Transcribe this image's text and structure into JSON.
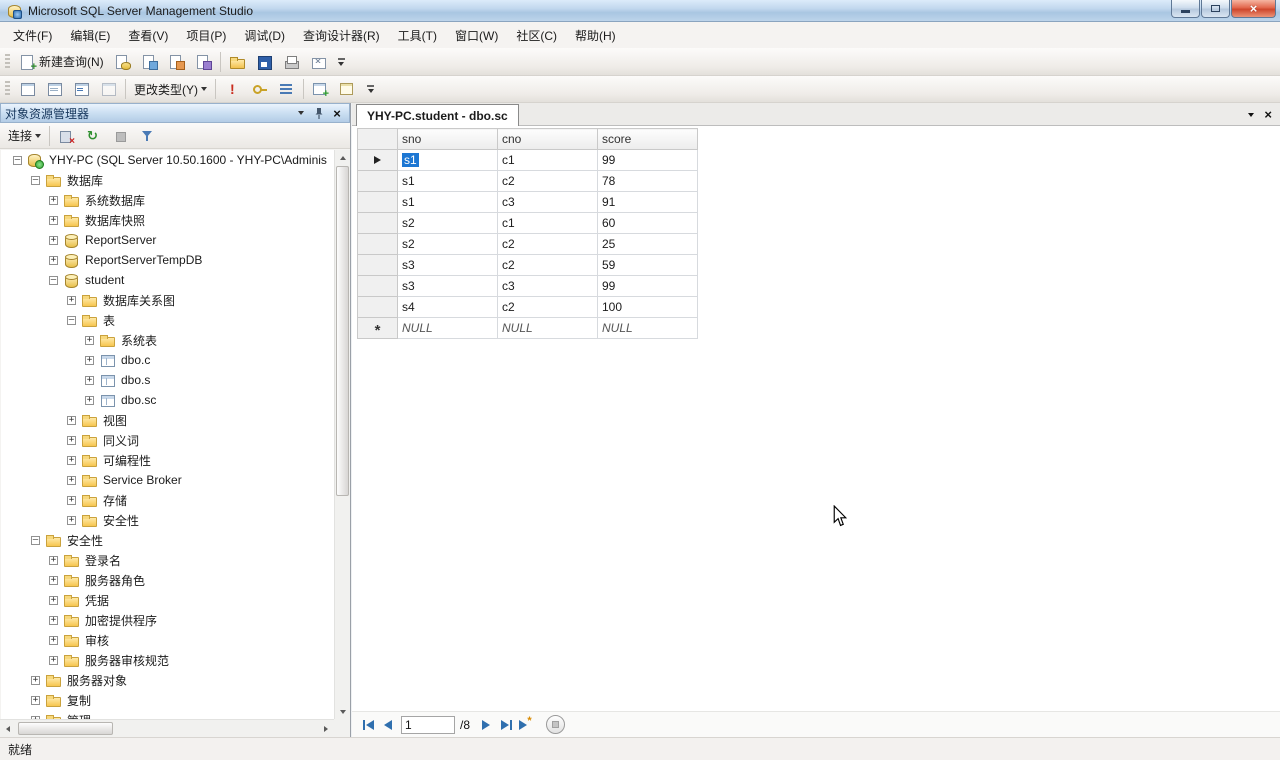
{
  "colors": {
    "titlebar_blue": "#b9d1e9",
    "close_red": "#ce462c",
    "selection_blue": "#1d77d3",
    "panel_header_blue": "#b3cce6",
    "nav_arrow_blue": "#2f6fae"
  },
  "window": {
    "title": "Microsoft SQL Server Management Studio"
  },
  "menu": {
    "items": [
      "文件(F)",
      "编辑(E)",
      "查看(V)",
      "项目(P)",
      "调试(D)",
      "查询设计器(R)",
      "工具(T)",
      "窗口(W)",
      "社区(C)",
      "帮助(H)"
    ]
  },
  "toolbar_standard": {
    "new_query_label": "新建查询(N)",
    "icons": [
      "database-engine-query-icon",
      "mdx-query-icon",
      "dmx-query-icon",
      "xmla-query-icon"
    ],
    "file_icons": [
      "open-file-icon",
      "save-icon",
      "print-icon",
      "mail-icon"
    ]
  },
  "toolbar_query": {
    "pane_icons": [
      "show-diagram-pane-icon",
      "show-grid-pane-icon",
      "show-sql-pane-icon",
      "show-results-pane-icon"
    ],
    "change_type_label": "更改类型(Y)",
    "exec_icons": [
      "execute-sql-icon",
      "verify-sql-icon",
      "add-group-by-icon"
    ],
    "table_icons": [
      "add-table-icon",
      "add-derived-table-icon"
    ]
  },
  "object_explorer": {
    "title": "对象资源管理器",
    "connect_label": "连接",
    "toolbar_icons": [
      "disconnect-icon",
      "refresh-icon",
      "stop-icon",
      "filter-icon"
    ],
    "tree": [
      {
        "label": "YHY-PC (SQL Server 10.50.1600 - YHY-PC\\Adminis",
        "level": 0,
        "expand": "-",
        "icon": "server"
      },
      {
        "label": "数据库",
        "level": 1,
        "expand": "-",
        "icon": "folder"
      },
      {
        "label": "系统数据库",
        "level": 2,
        "expand": "+",
        "icon": "folder"
      },
      {
        "label": "数据库快照",
        "level": 2,
        "expand": "+",
        "icon": "folder"
      },
      {
        "label": "ReportServer",
        "level": 2,
        "expand": "+",
        "icon": "db"
      },
      {
        "label": "ReportServerTempDB",
        "level": 2,
        "expand": "+",
        "icon": "db"
      },
      {
        "label": "student",
        "level": 2,
        "expand": "-",
        "icon": "db"
      },
      {
        "label": "数据库关系图",
        "level": 3,
        "expand": "+",
        "icon": "folder"
      },
      {
        "label": "表",
        "level": 3,
        "expand": "-",
        "icon": "folder"
      },
      {
        "label": "系统表",
        "level": 4,
        "expand": "+",
        "icon": "folder"
      },
      {
        "label": "dbo.c",
        "level": 4,
        "expand": "+",
        "icon": "table"
      },
      {
        "label": "dbo.s",
        "level": 4,
        "expand": "+",
        "icon": "table"
      },
      {
        "label": "dbo.sc",
        "level": 4,
        "expand": "+",
        "icon": "table"
      },
      {
        "label": "视图",
        "level": 3,
        "expand": "+",
        "icon": "folder"
      },
      {
        "label": "同义词",
        "level": 3,
        "expand": "+",
        "icon": "folder"
      },
      {
        "label": "可编程性",
        "level": 3,
        "expand": "+",
        "icon": "folder"
      },
      {
        "label": "Service Broker",
        "level": 3,
        "expand": "+",
        "icon": "folder"
      },
      {
        "label": "存储",
        "level": 3,
        "expand": "+",
        "icon": "folder"
      },
      {
        "label": "安全性",
        "level": 3,
        "expand": "+",
        "icon": "folder"
      },
      {
        "label": "安全性",
        "level": 1,
        "expand": "-",
        "icon": "folder"
      },
      {
        "label": "登录名",
        "level": 2,
        "expand": "+",
        "icon": "folder"
      },
      {
        "label": "服务器角色",
        "level": 2,
        "expand": "+",
        "icon": "folder"
      },
      {
        "label": "凭据",
        "level": 2,
        "expand": "+",
        "icon": "folder"
      },
      {
        "label": "加密提供程序",
        "level": 2,
        "expand": "+",
        "icon": "folder"
      },
      {
        "label": "审核",
        "level": 2,
        "expand": "+",
        "icon": "folder"
      },
      {
        "label": "服务器审核规范",
        "level": 2,
        "expand": "+",
        "icon": "folder"
      },
      {
        "label": "服务器对象",
        "level": 1,
        "expand": "+",
        "icon": "folder"
      },
      {
        "label": "复制",
        "level": 1,
        "expand": "+",
        "icon": "folder"
      },
      {
        "label": "管理",
        "level": 1,
        "expand": "+",
        "icon": "folder"
      }
    ]
  },
  "document": {
    "tab_title": "YHY-PC.student - dbo.sc",
    "grid": {
      "columns": [
        "sno",
        "cno",
        "score"
      ],
      "rows": [
        [
          "s1",
          "c1",
          "99"
        ],
        [
          "s1",
          "c2",
          "78"
        ],
        [
          "s1",
          "c3",
          "91"
        ],
        [
          "s2",
          "c1",
          "60"
        ],
        [
          "s2",
          "c2",
          "25"
        ],
        [
          "s3",
          "c2",
          "59"
        ],
        [
          "s3",
          "c3",
          "99"
        ],
        [
          "s4",
          "c2",
          "100"
        ]
      ],
      "new_row": [
        "NULL",
        "NULL",
        "NULL"
      ],
      "selected": {
        "row": 0,
        "col": 0
      }
    },
    "navigator": {
      "position": "1",
      "count_label": "/8"
    }
  },
  "status_bar": {
    "text": "就绪"
  }
}
